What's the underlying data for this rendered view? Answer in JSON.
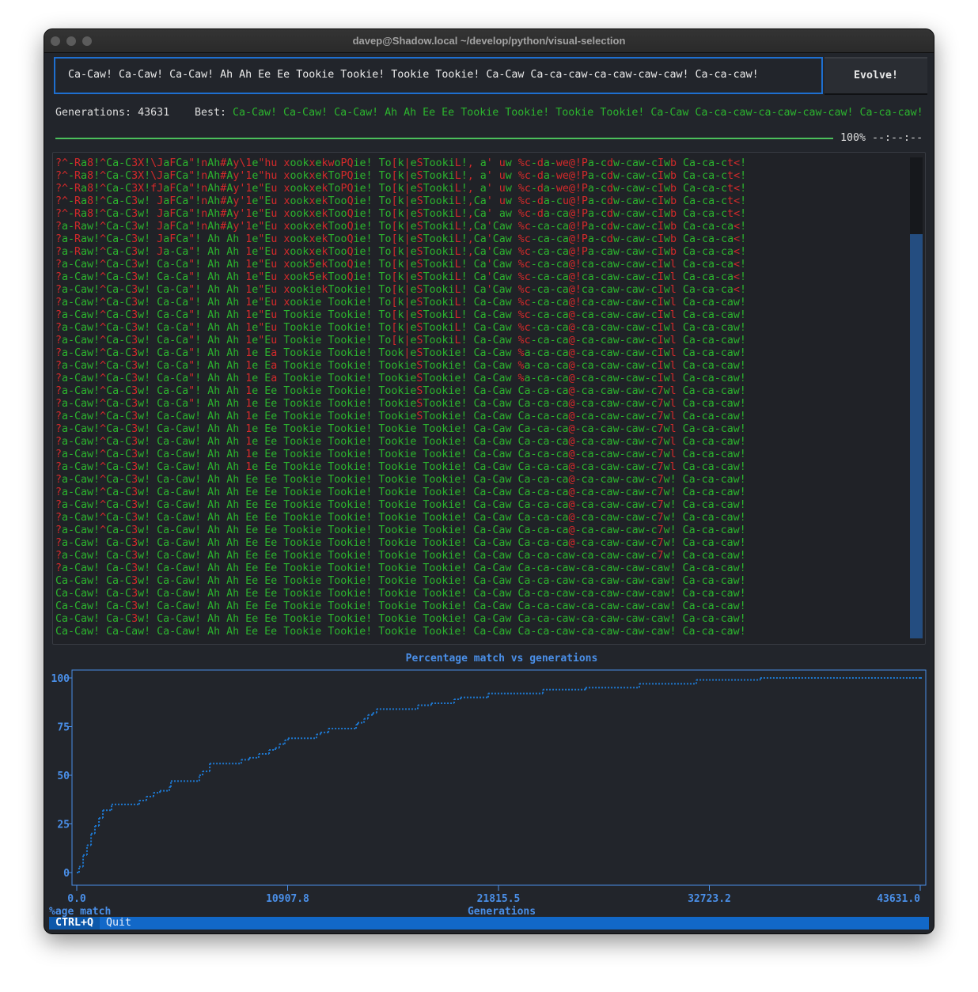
{
  "window": {
    "title": "davep@Shadow.local ~/develop/python/visual-selection"
  },
  "target": {
    "value": "Ca-Caw! Ca-Caw! Ca-Caw! Ah Ah Ee Ee Tookie Tookie! Tookie Tookie! Ca-Caw Ca-ca-caw-ca-caw-caw-caw! Ca-ca-caw!"
  },
  "evolve_button": "Evolve!",
  "stats": {
    "generations_label": "Generations: 43631",
    "best_label": "Best:",
    "best_value": "Ca-Caw! Ca-Caw! Ca-Caw! Ah Ah Ee Ee Tookie Tookie! Tookie Tookie! Ca-Caw Ca-ca-caw-ca-caw-caw-caw! Ca-ca-caw!"
  },
  "progress": {
    "percent": 100,
    "label": "100% --:--:--"
  },
  "colors": {
    "match": "#2cb52e",
    "mismatch": "#d42a2a",
    "accent": "#1e6fd0",
    "chart": "#4a8fe8",
    "series": "#1e78d0",
    "footer": "#1268c8"
  },
  "log": {
    "scroll_thumb_fraction": 0.84,
    "lines": [
      "?^-Ra8!^Ca-C3X!\\JaFCa\"!nAh#Ay\\1e\"hu xookxekwoPQie! To[k|eSTookiL!, a' uw %c-da-we@!Pa-cdw-caw-cIwb Ca-ca-ct<!",
      "?^-Ra8!^Ca-C3X!\\JaFCa\"!nAh#Ay'1e\"hu xookxekToPQie! To[k|eSTookiL!, a' uw %c-da-we@!Pa-cdw-caw-cIwb Ca-ca-ct<!",
      "?^-Ra8!^Ca-C3X!fJaFCa\"!nAh#Ay'1e\"Eu xookxekToPQie! To[k|eSTookiL!, a' uw %c-da-we@!Pa-cdw-caw-cIwb Ca-ca-ct<!",
      "?^-Ra8!^Ca-C3w! JaFCa\"!nAh#Ay'1e\"Eu xookxekTooQie! To[k|eSTookiL!,Ca' uw %c-da-cu@!Pa-cdw-caw-cIwb Ca-ca-ct<!",
      "?^-Ra8!^Ca-C3w! JaFCa\"!nAh#Ay'1e\"Eu xookxekTooQie! To[k|eSTookiL!,Ca' aw %c-da-ca@!Pa-cdw-caw-cIwb Ca-ca-ct<!",
      "?a-Raw!^Ca-C3w! JaFCa\"!nAh#Ay'1e\"Eu xookxekTooQie! To[k|eSTookiL!,Ca'Caw %c-ca-ca@!Pa-cdw-caw-cIwb Ca-ca-ca<!",
      "?a-Raw!^Ca-C3w! JaFCa\"! Ah Ah 1e\"Eu xookxekTooQie! To[k|eSTookiL!,Ca'Caw %c-ca-ca@!Pa-cdw-caw-cIwb Ca-ca-ca<!",
      "?a-Raw!^Ca-C3w! Ja-Ca\"! Ah Ah 1e\"Eu xookxekTooQie! To[k|eSTookiL!,Ca'Caw %c-ca-ca@!Pa-caw-caw-cIwb Ca-ca-ca<!",
      "?a-Caw!^Ca-C3w! Ca-Ca\"! Ah Ah 1e\"Eu xook5ekTooQie! To[k|eSTookiL! Ca'Caw %c-ca-ca@!ca-caw-caw-cIwl Ca-ca-ca<!",
      "?a-Caw!^Ca-C3w! Ca-Ca\"! Ah Ah 1e\"Eu xook5ekTooQie! To[k|eSTookiL! Ca'Caw %c-ca-ca@!ca-caw-caw-cIwl Ca-ca-ca<!",
      "?a-Caw!^Ca-C3w! Ca-Ca\"! Ah Ah 1e\"Eu xookiekTookie! To[k|eSTookiL! Ca'Caw %c-ca-ca@!ca-caw-caw-cIwl Ca-ca-ca<!",
      "?a-Caw!^Ca-C3w! Ca-Ca\"! Ah Ah 1e\"Eu xookie Tookie! To[k|eSTookiL! Ca-Caw %c-ca-ca@!ca-caw-caw-cIwl Ca-ca-caw!",
      "?a-Caw!^Ca-C3w! Ca-Ca\"! Ah Ah 1e\"Eu Tookie Tookie! To[k|eSTookiL! Ca-Caw %c-ca-ca@-ca-caw-caw-cIwl Ca-ca-caw!",
      "?a-Caw!^Ca-C3w! Ca-Ca\"! Ah Ah 1e\"Eu Tookie Tookie! To[k|eSTookiL! Ca-Caw %c-ca-ca@-ca-caw-caw-cIwl Ca-ca-caw!",
      "?a-Caw!^Ca-C3w! Ca-Ca\"! Ah Ah 1e\"Eu Tookie Tookie! To[k|eSTookiL! Ca-Caw %c-ca-ca@-ca-caw-caw-cIwl Ca-ca-caw!",
      "?a-Caw!^Ca-C3w! Ca-Ca\"! Ah Ah 1e Ea Tookie Tookie! Took|eSTookie! Ca-Caw %a-ca-ca@-ca-caw-caw-cIwl Ca-ca-caw!",
      "?a-Caw!^Ca-C3w! Ca-Ca\"! Ah Ah 1e Ea Tookie Tookie! TookieSTookie! Ca-Caw %a-ca-ca@-ca-caw-caw-cIwl Ca-ca-caw!",
      "?a-Caw!^Ca-C3w! Ca-Ca\"! Ah Ah 1e Ea Tookie Tookie! TookieSTookie! Ca-Caw %a-ca-ca@-ca-caw-caw-cIwl Ca-ca-caw!",
      "?a-Caw!^Ca-C3w! Ca-Ca\"! Ah Ah 1e Ee Tookie Tookie! TookieSTookie! Ca-Caw Ca-ca-ca@-ca-caw-caw-c7wl Ca-ca-caw!",
      "?a-Caw!^Ca-C3w! Ca-Ca\"! Ah Ah 1e Ee Tookie Tookie! TookieSTookie! Ca-Caw Ca-ca-ca@-ca-caw-caw-c7wl Ca-ca-caw!",
      "?a-Caw!^Ca-C3w! Ca-Caw! Ah Ah 1e Ee Tookie Tookie! TookieSTookie! Ca-Caw Ca-ca-ca@-ca-caw-caw-c7wl Ca-ca-caw!",
      "?a-Caw!^Ca-C3w! Ca-Caw! Ah Ah 1e Ee Tookie Tookie! Tookie Tookie! Ca-Caw Ca-ca-ca@-ca-caw-caw-c7wl Ca-ca-caw!",
      "?a-Caw!^Ca-C3w! Ca-Caw! Ah Ah 1e Ee Tookie Tookie! Tookie Tookie! Ca-Caw Ca-ca-ca@-ca-caw-caw-c7wl Ca-ca-caw!",
      "?a-Caw!^Ca-C3w! Ca-Caw! Ah Ah 1e Ee Tookie Tookie! Tookie Tookie! Ca-Caw Ca-ca-ca@-ca-caw-caw-c7wl Ca-ca-caw!",
      "?a-Caw!^Ca-C3w! Ca-Caw! Ah Ah 1e Ee Tookie Tookie! Tookie Tookie! Ca-Caw Ca-ca-ca@-ca-caw-caw-c7wl Ca-ca-caw!",
      "?a-Caw!^Ca-C3w! Ca-Caw! Ah Ah Ee Ee Tookie Tookie! Tookie Tookie! Ca-Caw Ca-ca-ca@-ca-caw-caw-c7w! Ca-ca-caw!",
      "?a-Caw!^Ca-C3w! Ca-Caw! Ah Ah Ee Ee Tookie Tookie! Tookie Tookie! Ca-Caw Ca-ca-ca@-ca-caw-caw-c7w! Ca-ca-caw!",
      "?a-Caw!^Ca-C3w! Ca-Caw! Ah Ah Ee Ee Tookie Tookie! Tookie Tookie! Ca-Caw Ca-ca-ca@-ca-caw-caw-c7w! Ca-ca-caw!",
      "?a-Caw!^Ca-C3w! Ca-Caw! Ah Ah Ee Ee Tookie Tookie! Tookie Tookie! Ca-Caw Ca-ca-ca@-ca-caw-caw-c7w! Ca-ca-caw!",
      "?a-Caw!^Ca-C3w! Ca-Caw! Ah Ah Ee Ee Tookie Tookie! Tookie Tookie! Ca-Caw Ca-ca-ca@-ca-caw-caw-c7w! Ca-ca-caw!",
      "?a-Caw! Ca-C3w! Ca-Caw! Ah Ah Ee Ee Tookie Tookie! Tookie Tookie! Ca-Caw Ca-ca-ca@-ca-caw-caw-c7w! Ca-ca-caw!",
      "?a-Caw! Ca-C3w! Ca-Caw! Ah Ah Ee Ee Tookie Tookie! Tookie Tookie! Ca-Caw Ca-ca-caw-ca-caw-caw-c7w! Ca-ca-caw!",
      "?a-Caw! Ca-C3w! Ca-Caw! Ah Ah Ee Ee Tookie Tookie! Tookie Tookie! Ca-Caw Ca-ca-caw-ca-caw-caw-caw! Ca-ca-caw!",
      "Ca-Caw! Ca-C3w! Ca-Caw! Ah Ah Ee Ee Tookie Tookie! Tookie Tookie! Ca-Caw Ca-ca-caw-ca-caw-caw-caw! Ca-ca-caw!",
      "Ca-Caw! Ca-C3w! Ca-Caw! Ah Ah Ee Ee Tookie Tookie! Tookie Tookie! Ca-Caw Ca-ca-caw-ca-caw-caw-caw! Ca-ca-caw!",
      "Ca-Caw! Ca-C3w! Ca-Caw! Ah Ah Ee Ee Tookie Tookie! Tookie Tookie! Ca-Caw Ca-ca-caw-ca-caw-caw-caw! Ca-ca-caw!",
      "Ca-Caw! Ca-C3w! Ca-Caw! Ah Ah Ee Ee Tookie Tookie! Tookie Tookie! Ca-Caw Ca-ca-caw-ca-caw-caw-caw! Ca-ca-caw!",
      "Ca-Caw! Ca-Caw! Ca-Caw! Ah Ah Ee Ee Tookie Tookie! Tookie Tookie! Ca-Caw Ca-ca-caw-ca-caw-caw-caw! Ca-ca-caw!"
    ]
  },
  "chart_data": {
    "type": "line",
    "title": "Percentage match vs generations",
    "xlabel": "Generations",
    "ylabel": "%age match",
    "xlim": [
      0,
      43631
    ],
    "ylim": [
      -6,
      105
    ],
    "x_ticks": [
      "0.0",
      "10907.8",
      "21815.5",
      "32723.2",
      "43631.0"
    ],
    "x_tick_values": [
      0,
      10907.8,
      21815.5,
      32723.2,
      43631
    ],
    "y_ticks": [
      "0",
      "25",
      "50",
      "75",
      "100"
    ],
    "y_tick_values": [
      0,
      25,
      50,
      75,
      100
    ],
    "grid": false,
    "style": "dotted step",
    "series": [
      {
        "x": [
          0,
          120,
          330,
          530,
          740,
          940,
          1150,
          1350,
          1800,
          3230,
          3600,
          3970,
          4300,
          4790,
          4870,
          6340,
          6510,
          6880,
          8510,
          8920,
          9410,
          9950,
          10270,
          10480,
          10760,
          10930,
          12400,
          12610,
          13020,
          14450,
          14530,
          14860,
          15060,
          15310,
          15510,
          17640,
          18340,
          19520,
          19850,
          21280,
          24110,
          26320,
          29100,
          32050,
          35360,
          43631
        ],
        "y": [
          0,
          3,
          9,
          14,
          20,
          24,
          28,
          32,
          35,
          37,
          39,
          41,
          42,
          44,
          47,
          50,
          52,
          56,
          58,
          59,
          61,
          63,
          64,
          66,
          68,
          69,
          71,
          72,
          74,
          76,
          77,
          79,
          81,
          82,
          84,
          86,
          87,
          89,
          90,
          92,
          94,
          95,
          97,
          99,
          100,
          100
        ]
      }
    ]
  },
  "footer": {
    "key": "CTRL+Q",
    "action": "Quit"
  }
}
